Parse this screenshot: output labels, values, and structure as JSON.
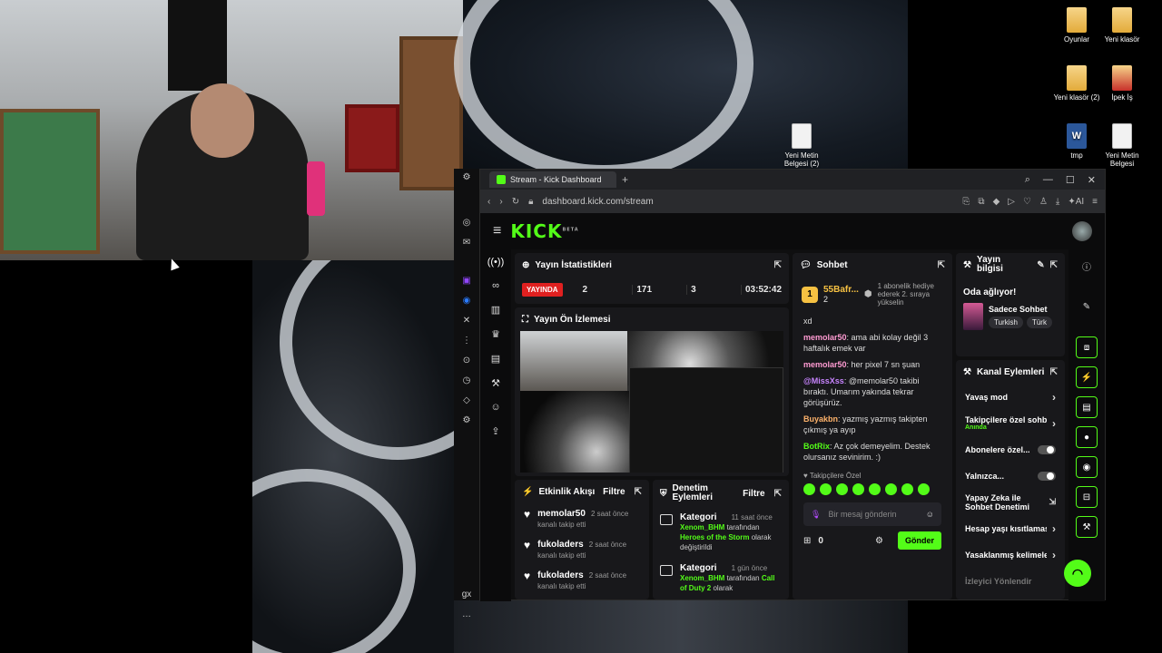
{
  "desktop": {
    "icons": [
      {
        "label": "Oyunlar",
        "type": "folder"
      },
      {
        "label": "Yeni klasör",
        "type": "folder"
      },
      {
        "label": "Yeni klasör (2)",
        "type": "folder"
      },
      {
        "label": "İpek İş",
        "type": "red"
      },
      {
        "label": "tmp",
        "type": "word"
      },
      {
        "label": "Yeni Metin Belgesi",
        "type": "doc"
      },
      {
        "label": "Yeni Metin Belgesi (2)",
        "type": "doc"
      }
    ]
  },
  "browser": {
    "tab_title": "Stream - Kick Dashboard",
    "url": "dashboard.kick.com/stream",
    "logo": "KICK",
    "logo_beta": "BETA"
  },
  "stats": {
    "title": "Yayın İstatistikleri",
    "live_label": "YAYINDA",
    "viewers": "2",
    "followers": "171",
    "subs": "3",
    "duration": "03:52:42"
  },
  "preview": {
    "title": "Yayın Ön İzlemesi"
  },
  "activity": {
    "title": "Etkinlik Akışı",
    "filter": "Filtre",
    "items": [
      {
        "name": "memolar50",
        "time": "2 saat önce",
        "sub": "kanalı takip etti"
      },
      {
        "name": "fukoladers",
        "time": "2 saat önce",
        "sub": "kanalı takip etti"
      },
      {
        "name": "fukoladers",
        "time": "2 saat önce",
        "sub": "kanalı takip etti"
      }
    ]
  },
  "moderation": {
    "title": "Denetim Eylemleri",
    "filter": "Filtre",
    "items": [
      {
        "title": "Kategori",
        "time": "11 saat önce",
        "user": "Xenom_BHM",
        "mid": " tarafından ",
        "category": "Heroes of the Storm",
        "tail": " olarak değiştirildi"
      },
      {
        "title": "Kategori",
        "time": "1 gün önce",
        "user": "Xenom_BHM",
        "mid": " tarafından ",
        "category": "Call of Duty 2",
        "tail": " olarak"
      }
    ]
  },
  "chat": {
    "title": "Sohbet",
    "gift_rank": "1",
    "gift_user": "55Bafr...",
    "gift_count": "2",
    "gift_note": "1 abonelik hediye ederek 2. sıraya yükselin",
    "messages": [
      {
        "user": "",
        "text": "xd",
        "color": "#53fc18"
      },
      {
        "user": "memolar50",
        "text": ": ama abi kolay değil 3 haftalık emek var",
        "color": "#ff9bd2"
      },
      {
        "user": "memolar50",
        "text": ": her pixel 7 sn şuan",
        "color": "#ff9bd2"
      },
      {
        "user": "@MissXss",
        "text": ": @memolar50 takibi bıraktı. Umarım yakında tekrar görüşürüz.",
        "color": "#c884ff"
      },
      {
        "user": "Buyakbn",
        "text": ": yazmış yazmış takipten çıkmış ya ayıp",
        "color": "#ffb36b"
      },
      {
        "user": "BotRix",
        "text": ": Az çok demeyelim. Destek olursanız sevinirim. :)",
        "color": "#53fc18"
      }
    ],
    "followers_only": "Takipçilere Özel",
    "placeholder": "Bir mesaj gönderin",
    "viewer_count": "0",
    "send": "Gönder"
  },
  "stream_info": {
    "title": "Yayın bilgisi",
    "now_playing": "Oda ağlıyor!",
    "category": "Sadece Sohbet",
    "tags": [
      "Turkish",
      "Türk"
    ]
  },
  "channel_actions": {
    "title": "Kanal Eylemleri",
    "items": [
      {
        "label": "Yavaş mod",
        "control": "arrow"
      },
      {
        "label": "Takipçilere özel sohbet",
        "sub": "Anında",
        "control": "arrow"
      },
      {
        "label": "Abonelere özel...",
        "control": "toggle"
      },
      {
        "label": "Yalnızca...",
        "control": "toggle"
      },
      {
        "label": "Yapay Zeka ile Sohbet Denetimi",
        "control": "link"
      },
      {
        "label": "Hesap yaşı kısıtlaması",
        "control": "arrow"
      },
      {
        "label": "Yasaklanmış kelimeler",
        "control": "arrow"
      },
      {
        "label": "İzleyici Yönlendir",
        "control": "none"
      }
    ]
  }
}
